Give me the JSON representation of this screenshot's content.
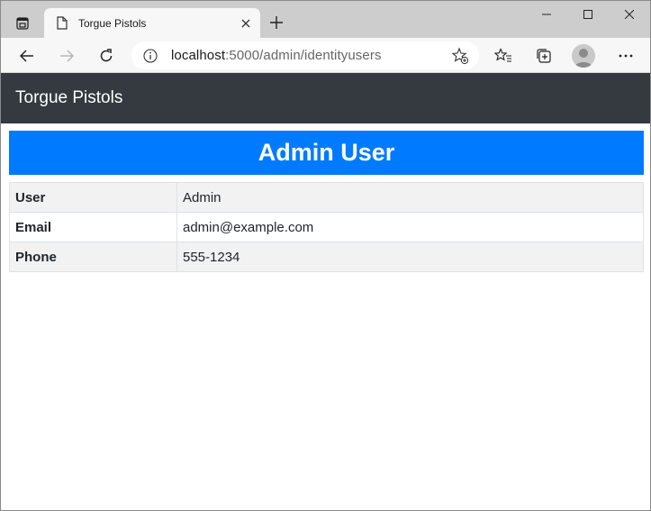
{
  "browser": {
    "tab": {
      "title": "Torgue Pistols"
    },
    "address": {
      "host": "localhost",
      "rest": ":5000/admin/identityusers"
    }
  },
  "page": {
    "brand": "Torgue Pistols",
    "heading": "Admin User",
    "rows": [
      {
        "label": "User",
        "value": "Admin"
      },
      {
        "label": "Email",
        "value": "admin@example.com"
      },
      {
        "label": "Phone",
        "value": "555-1234"
      }
    ]
  },
  "colors": {
    "navbar": "#343a40",
    "banner": "#007bff",
    "tabstrip": "#cdcdcd"
  }
}
